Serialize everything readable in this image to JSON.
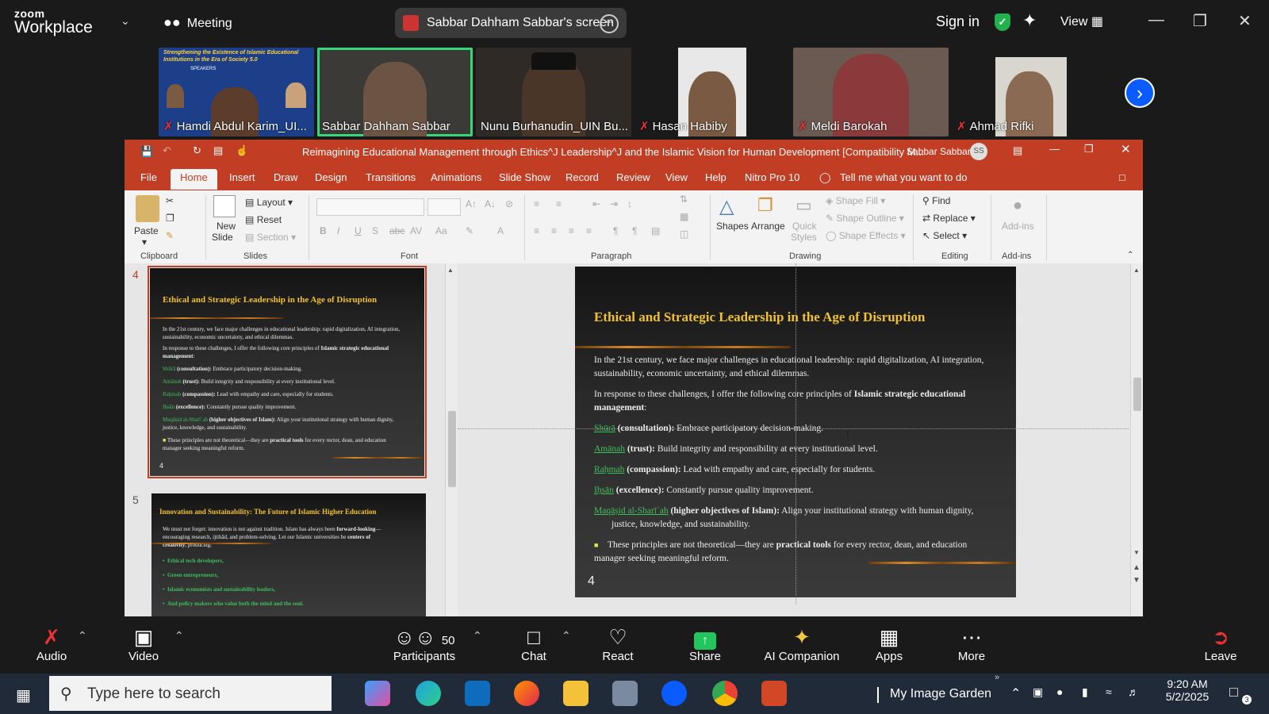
{
  "zoom": {
    "logo_top": "zoom",
    "logo_bottom": "Workplace",
    "meeting_label": "Meeting",
    "share_banner": "Sabbar Dahham Sabbar's screen",
    "sign_in": "Sign in",
    "view": "View",
    "shield_color": "#22b14c",
    "gallery": [
      {
        "name": "Hamdi Abdul Karim_UI...",
        "muted": true
      },
      {
        "name": "Sabbar Dahham Sabbar",
        "muted": false,
        "active": true
      },
      {
        "name": "Nunu Burhanudin_UIN Bu...",
        "muted": false
      },
      {
        "name": "Hasan Habiby",
        "muted": true
      },
      {
        "name": "Meldi Barokah",
        "muted": true
      },
      {
        "name": "Ahmad Rifki",
        "muted": true
      }
    ],
    "banner_tile": {
      "title": "Strengthening the Existence of Islamic Educational Institutions in the Era of Society 5.0",
      "speakers": "SPEAKERS"
    },
    "toolbar": {
      "audio": "Audio",
      "video": "Video",
      "participants": "Participants",
      "participants_count": "50",
      "chat": "Chat",
      "react": "React",
      "share": "Share",
      "ai_companion": "AI Companion",
      "apps": "Apps",
      "more": "More",
      "leave": "Leave"
    }
  },
  "ppt": {
    "title": "Reimagining Educational Management through Ethics^J Leadership^J and the Islamic Vision for Human Development [Compatibility M...",
    "user": "Sabbar Sabbar",
    "user_initials": "SS",
    "accent": "#c13d23",
    "tabs": [
      "File",
      "Home",
      "Insert",
      "Draw",
      "Design",
      "Transitions",
      "Animations",
      "Slide Show",
      "Record",
      "Review",
      "View",
      "Help",
      "Nitro Pro 10"
    ],
    "tell_me": "Tell me what you want to do",
    "ribbon": {
      "paste": "Paste",
      "new_slide_1": "New",
      "new_slide_2": "Slide",
      "layout": "Layout",
      "reset": "Reset",
      "section": "Section",
      "shapes": "Shapes",
      "arrange": "Arrange",
      "quick_styles_1": "Quick",
      "quick_styles_2": "Styles",
      "shape_fill": "Shape Fill",
      "shape_outline": "Shape Outline",
      "shape_effects": "Shape Effects",
      "find": "Find",
      "replace": "Replace",
      "select": "Select",
      "addins": "Add-ins",
      "groups": {
        "clipboard": "Clipboard",
        "slides": "Slides",
        "font": "Font",
        "paragraph": "Paragraph",
        "drawing": "Drawing",
        "editing": "Editing",
        "addins": "Add-ins"
      }
    },
    "thumb_nums": [
      "4",
      "5"
    ],
    "slide4": {
      "title": "Ethical and Strategic Leadership in the Age of Disruption",
      "p1": "In the 21st century, we face major challenges in educational leadership: rapid digitalization, AI integration, sustainability, economic uncertainty, and ethical dilemmas.",
      "p2_pre": "In response to these challenges, I offer the following core principles of ",
      "p2_bold": "Islamic strategic educational management",
      "p2_post": ":",
      "items": [
        {
          "term": "Shūrā",
          "bold": " (consultation):",
          "text": " Embrace participatory decision-making."
        },
        {
          "term": "Amānah",
          "bold": " (trust):",
          "text": " Build integrity and responsibility at every institutional level."
        },
        {
          "term": "Raḥmah",
          "bold": " (compassion):",
          "text": " Lead with empathy and care, especially for students."
        },
        {
          "term": "Iḥsān",
          "bold": " (excellence):",
          "text": " Constantly pursue quality improvement."
        },
        {
          "term": "Maqāṣid al-Sharīʿah",
          "bold": " (higher objectives of Islam):",
          "text": " Align your institutional strategy with human dignity, justice, knowledge, and sustainability."
        }
      ],
      "bullet_pre": "These principles are not theoretical—they are ",
      "bullet_bold": "practical tools",
      "bullet_post": " for every rector, dean, and education manager seeking meaningful reform.",
      "num": "4"
    },
    "slide5": {
      "title": "Innovation and Sustainability: The Future of Islamic Higher Education",
      "p1_pre": "We must not forget: innovation is not against tradition. Islam has always been ",
      "p1_bold": "forward-looking",
      "p1_mid": "—encouraging research, ijtihād, and problem-solving. Let our Islamic universities be ",
      "p1_bold2": "centers of creativity",
      "p1_post": ", producing:",
      "items": [
        "Ethical tech developers,",
        "Green entrepreneurs,",
        "Islamic economists and sustainability leaders,",
        "And policy makers who value both the mind and the soul."
      ]
    }
  },
  "taskbar": {
    "search_placeholder": "Type here to search",
    "tray_label": "My Image Garden",
    "time": "9:20 AM",
    "date": "5/2/2025",
    "notif_count": "3"
  }
}
